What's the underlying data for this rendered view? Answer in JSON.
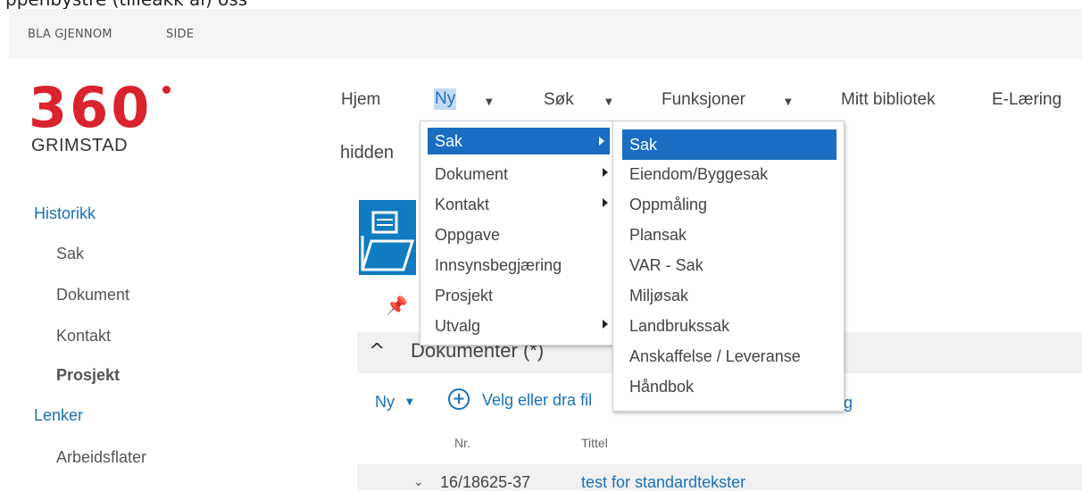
{
  "header": {
    "cut_text": "ppenbystre (tilleakk al) oss"
  },
  "ribbon": {
    "tabs": [
      "BLA GJENNOM",
      "SIDE"
    ]
  },
  "logo": {
    "number": "360",
    "town": "GRIMSTAD",
    "brand_color": "#d9232d"
  },
  "sidebar": {
    "historikk": "Historikk",
    "sak": "Sak",
    "dokument": "Dokument",
    "kontakt": "Kontakt",
    "prosjekt": "Prosjekt",
    "lenker": "Lenker",
    "arbeidsflater": "Arbeidsflater"
  },
  "topnav": {
    "hjem": "Hjem",
    "ny": "Ny",
    "sok": "Søk",
    "funksjoner": "Funksjoner",
    "mitt_bibliotek": "Mitt bibliotek",
    "elaering": "E-Læring",
    "hidden": "hidden"
  },
  "menu_ny": {
    "items": [
      "Sak",
      "Dokument",
      "Kontakt",
      "Oppgave",
      "Innsynsbegjæring",
      "Prosjekt",
      "Utvalg"
    ]
  },
  "menu_sak": {
    "items": [
      "Sak",
      "Eiendom/Byggesak",
      "Oppmåling",
      "Plansak",
      "VAR - Sak",
      "Miljøsak",
      "Landbrukssak",
      "Anskaffelse / Leveranse",
      "Håndbok"
    ]
  },
  "content": {
    "section_title": "Dokumenter (*)",
    "ny_link": "Ny",
    "upload_link": "Velg eller dra fil",
    "upload_tail": "ng",
    "col_nr": "Nr.",
    "col_tittel": "Tittel",
    "row_nr": "16/18625-37",
    "row_title": "test for standardtekster"
  },
  "colors": {
    "accent": "#1a72b8",
    "highlight": "#1a6dc2"
  }
}
